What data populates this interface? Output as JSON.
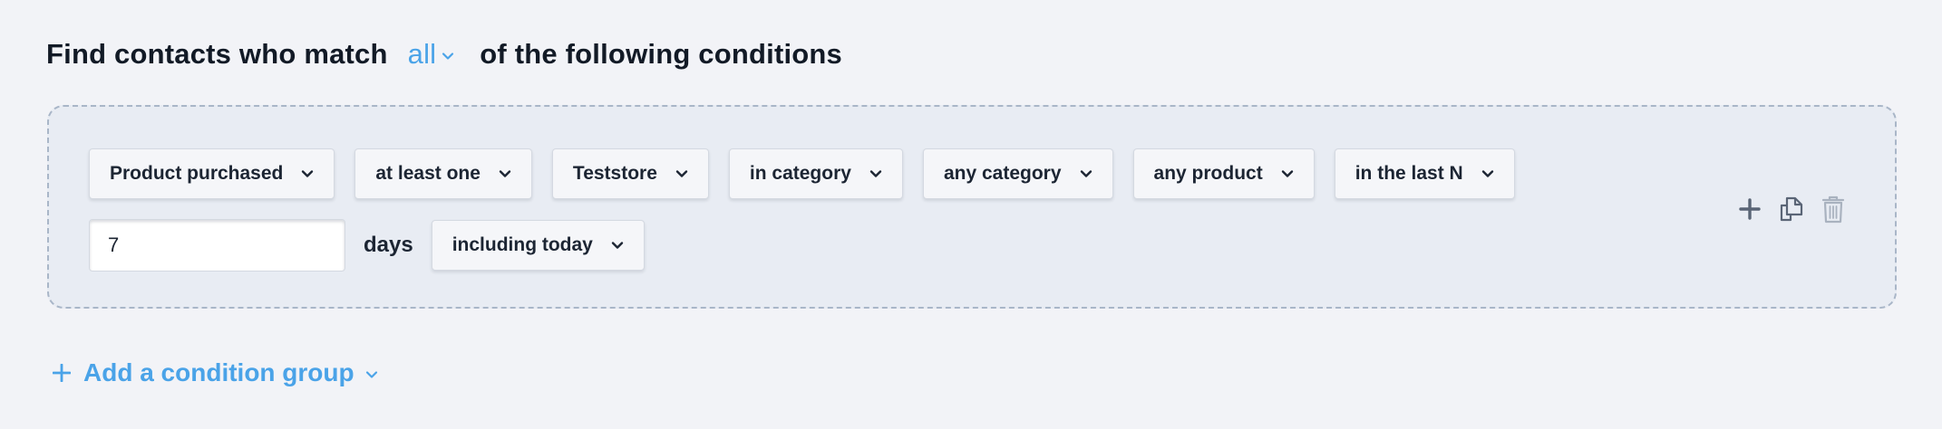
{
  "header": {
    "prefix": "Find contacts who match",
    "match_value": "all",
    "suffix": "of the following conditions"
  },
  "condition": {
    "row1": [
      {
        "name": "event-type-select",
        "label": "Product purchased"
      },
      {
        "name": "frequency-select",
        "label": "at least one"
      },
      {
        "name": "store-select",
        "label": "Teststore"
      },
      {
        "name": "filter-type-select",
        "label": "in category"
      },
      {
        "name": "category-select",
        "label": "any category"
      },
      {
        "name": "product-select",
        "label": "any product"
      },
      {
        "name": "timeframe-select",
        "label": "in the last N"
      }
    ],
    "days_value": "7",
    "days_label": "days",
    "today_option": "including today"
  },
  "actions": [
    "plus-icon",
    "duplicate-icon",
    "trash-icon"
  ],
  "add_group_label": "Add a condition group",
  "colors": {
    "accent": "#4aa3e8",
    "background": "#f2f3f7",
    "group_background": "#e8ecf3",
    "dashed_border": "#a9b6c8",
    "text": "#121a26",
    "icon": "#5a6576",
    "icon_disabled": "#a9b2bf"
  }
}
